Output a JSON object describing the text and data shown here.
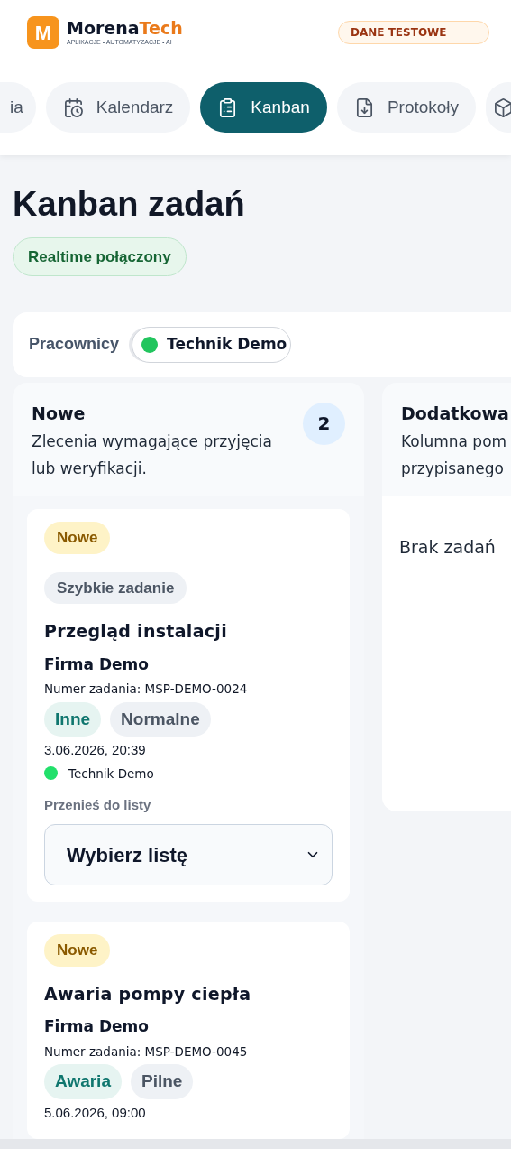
{
  "brand": {
    "logo_letter": "M",
    "name_main": "Morena",
    "name_accent": "Tech",
    "tagline": "APLIKACJE • AUTOMATYZACJE • AI"
  },
  "environment_badge": "DANE TESTOWE",
  "tabs": [
    {
      "label": "ia",
      "selected": false
    },
    {
      "label": "Kalendarz",
      "selected": false
    },
    {
      "label": "Kanban",
      "selected": true
    },
    {
      "label": "Protokoły",
      "selected": false
    },
    {
      "selected": false
    }
  ],
  "page_title": "Kanban zadań",
  "realtime_status": {
    "label": "Realtime połączony",
    "connected": true
  },
  "workers": {
    "label": "Pracownicy",
    "items": [
      {
        "name": "Technik Demo",
        "color": "#22c55e"
      }
    ]
  },
  "columns": [
    {
      "title": "Nowe",
      "count": "2",
      "description_lines": [
        "Zlecenia wymagające przyjęcia",
        "lub weryfikacji."
      ],
      "tasks": [
        {
          "status": "Nowe",
          "tag": "Szybkie zadanie",
          "title": "Przegląd instalacji",
          "client": "Firma Demo",
          "number": "Numer zadania: MSP-DEMO-0024",
          "category": "Inne",
          "priority": "Normalne",
          "date": "3.06.2026, 20:39",
          "assignee": {
            "name": "Technik Demo",
            "color": "#22e06b"
          },
          "move_label": "Przenieś do listy",
          "move_select": {
            "value": "Wybierz listę"
          }
        },
        {
          "status": "Nowe",
          "title": "Awaria pompy ciepła",
          "client": "Firma Demo",
          "number": "Numer zadania: MSP-DEMO-0045",
          "category": "Awaria",
          "priority": "Pilne",
          "date": "5.06.2026, 09:00"
        }
      ]
    },
    {
      "title": "Dodatkowa",
      "description_lines": [
        "Kolumna pom",
        "przypisanego"
      ],
      "empty_text": "Brak zadań"
    }
  ]
}
